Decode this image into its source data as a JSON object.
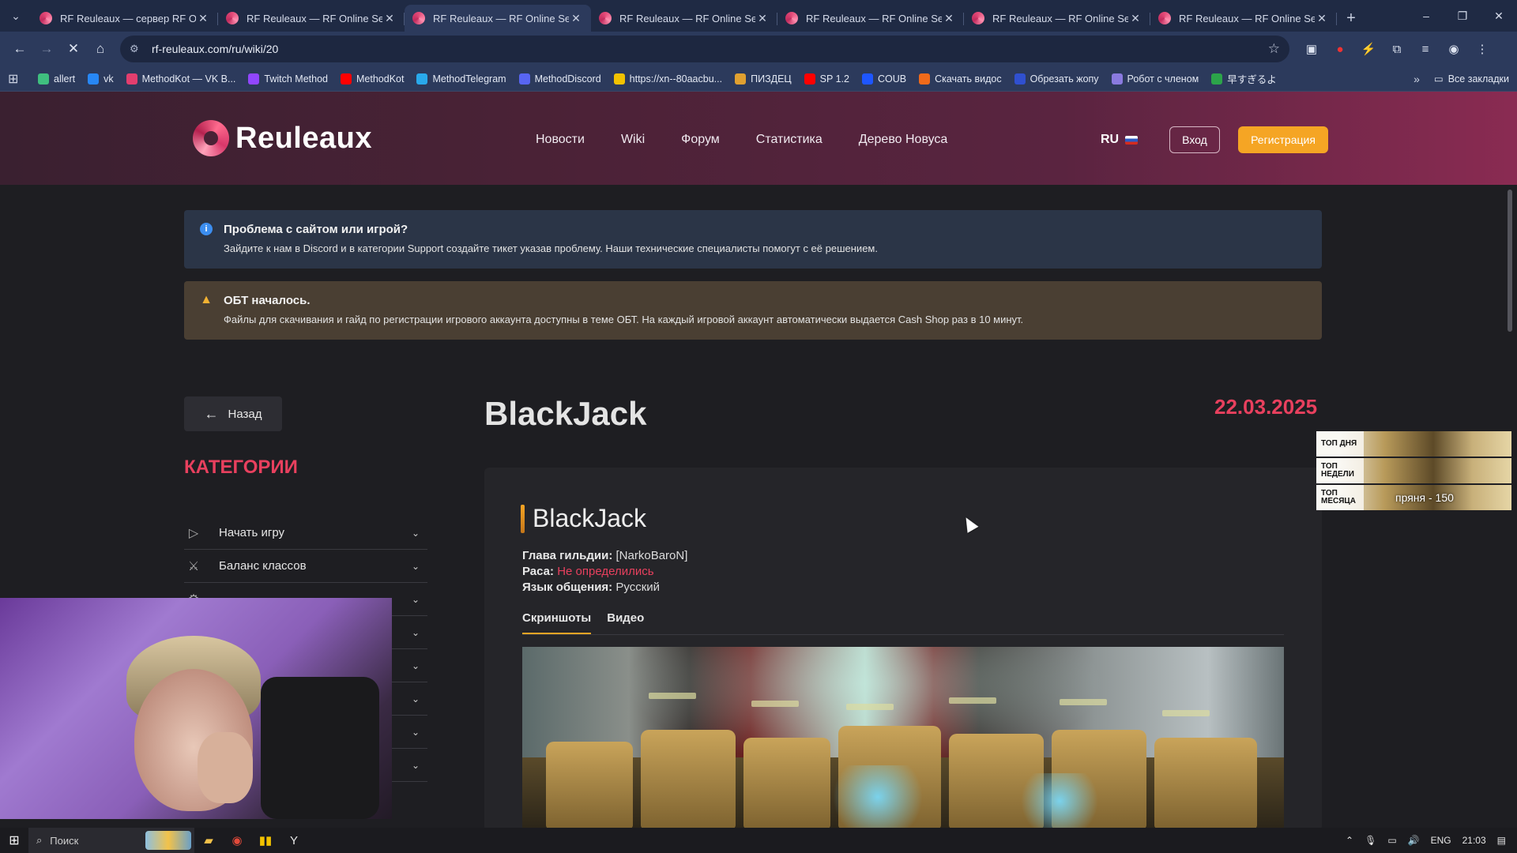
{
  "browser": {
    "tabs": [
      {
        "title": "RF Reuleaux — сервер RF Onli",
        "active": false
      },
      {
        "title": "RF Reuleaux — RF Online Serve",
        "active": false
      },
      {
        "title": "RF Reuleaux — RF Online Serve",
        "active": true
      },
      {
        "title": "RF Reuleaux — RF Online Serve",
        "active": false
      },
      {
        "title": "RF Reuleaux — RF Online Serve",
        "active": false
      },
      {
        "title": "RF Reuleaux — RF Online Serve",
        "active": false
      },
      {
        "title": "RF Reuleaux — RF Online Serve",
        "active": false
      }
    ],
    "url": "rf-reuleaux.com/ru/wiki/20",
    "bookmarks": [
      {
        "label": "allert",
        "color": "#3fbf7f"
      },
      {
        "label": "vk",
        "color": "#2787f5"
      },
      {
        "label": "MethodKot — VK B...",
        "color": "#e23e6e"
      },
      {
        "label": "Twitch Method",
        "color": "#9146ff"
      },
      {
        "label": "MethodKot",
        "color": "#ff0000"
      },
      {
        "label": "MethodTelegram",
        "color": "#29a9eb"
      },
      {
        "label": "MethodDiscord",
        "color": "#5865f2"
      },
      {
        "label": "https://xn--80aacbu...",
        "color": "#f2c200"
      },
      {
        "label": "ПИЗДЕЦ",
        "color": "#e0a030"
      },
      {
        "label": "SP 1.2",
        "color": "#ff0000"
      },
      {
        "label": "COUB",
        "color": "#1e56ff"
      },
      {
        "label": "Скачать видос",
        "color": "#f06a1a"
      },
      {
        "label": "Обрезать жопу",
        "color": "#3050d0"
      },
      {
        "label": "Робот с членом",
        "color": "#8a7ae0"
      },
      {
        "label": "早すぎるよ",
        "color": "#2ca44a"
      }
    ],
    "all_bookmarks": "Все закладки"
  },
  "header": {
    "logo": "Reuleaux",
    "nav": [
      "Новости",
      "Wiki",
      "Форум",
      "Статистика",
      "Дерево Новуса"
    ],
    "lang": "RU",
    "login": "Вход",
    "register": "Регистрация"
  },
  "alerts": {
    "info": {
      "title": "Проблема с сайтом или игрой?",
      "text": "Зайдите к нам в Discord и в категории Support создайте тикет указав проблему. Наши технические специалисты помогут с её решением."
    },
    "warn": {
      "title": "ОБТ началось.",
      "text": "Файлы для скачивания и гайд по регистрации игрового аккаунта доступны в теме ОБТ. На каждый игровой аккаунт автоматически выдается Cash Shop раз в 10 минут."
    }
  },
  "sidebar": {
    "back": "Назад",
    "title": "КАТЕГОРИИ",
    "items": [
      {
        "label": "Начать игру",
        "icon": "play-icon"
      },
      {
        "label": "Баланс классов",
        "icon": "class-balance-icon"
      }
    ]
  },
  "article": {
    "title": "BlackJack",
    "date": "22.03.2025",
    "card_title": "BlackJack",
    "guild_leader_label": "Глава гильдии:",
    "guild_leader": "[NarkoBaroN]",
    "race_label": "Раса:",
    "race": "Не определились",
    "lang_label": "Язык общения:",
    "lang": "Русский",
    "tabs": [
      "Скриншоты",
      "Видео"
    ]
  },
  "top_widget": {
    "rows": [
      {
        "label": "ТОП ДНЯ",
        "value": ""
      },
      {
        "label": "ТОП НЕДЕЛИ",
        "value": ""
      },
      {
        "label": "ТОП МЕСЯЦА",
        "value": "пряня - 150"
      }
    ]
  },
  "taskbar": {
    "search": "Поиск",
    "lang": "ENG",
    "time": "21:03"
  }
}
